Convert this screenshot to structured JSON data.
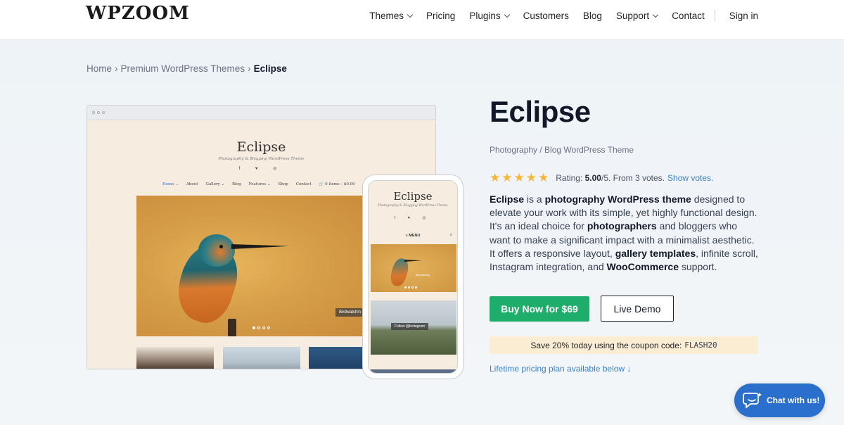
{
  "header": {
    "logo": "WPZOOM",
    "nav": {
      "themes": "Themes",
      "pricing": "Pricing",
      "plugins": "Plugins",
      "customers": "Customers",
      "blog": "Blog",
      "support": "Support",
      "contact": "Contact",
      "sign_in": "Sign in"
    }
  },
  "breadcrumb": {
    "home": "Home",
    "sep": "›",
    "category": "Premium WordPress Themes",
    "current": "Eclipse"
  },
  "preview": {
    "desktop": {
      "site_title": "Eclipse",
      "site_tagline": "Photography & Blogging WordPress Theme",
      "social": "f ♥ ◎",
      "nav": [
        "Home ⌄",
        "About",
        "Gallery ⌄",
        "Blog",
        "Features ⌄",
        "Shop",
        "Contact",
        "🛒 0 items – $0.00"
      ],
      "hero_label": "Birdwatchin"
    },
    "mobile": {
      "site_title": "Eclipse",
      "site_tagline": "Photography & Blogging WordPress Theme",
      "social": "f ♥ ◎",
      "menu": "≡ MENU",
      "search": "⌕",
      "hero_label": "Birdwatching",
      "follow": "Follow @Instagram"
    }
  },
  "product": {
    "title": "Eclipse",
    "subtitle": "Photography / Blog WordPress Theme",
    "rating": {
      "stars": 5,
      "label": "Rating:",
      "score": "5.00",
      "rest": "/5. From 3 votes.",
      "show_votes": "Show votes."
    },
    "description": {
      "p1": "Eclipse",
      "p2": " is a ",
      "p3": "photography WordPress theme",
      "p4": " designed to elevate your work with its simple, yet highly functional design. It's an ideal choice for ",
      "p5": "photographers",
      "p6": " and bloggers who want to make a significant impact with a minimalist aesthetic. It offers a responsive layout, ",
      "p7": "gallery templates",
      "p8": ", infinite scroll, Instagram integration, and ",
      "p9": "WooCommerce",
      "p10": " support."
    },
    "buy_label": "Buy Now for $69",
    "demo_label": "Live Demo",
    "coupon_text": "Save 20% today using the coupon code:",
    "coupon_code": "FLASH20",
    "lifetime": "Lifetime pricing plan available below ↓"
  },
  "chat": {
    "label": "Chat with us!"
  },
  "colors": {
    "buy_button": "#1fad6b",
    "star": "#f5b638",
    "link": "#3b82c4",
    "coupon_bg": "#fbecd4",
    "chat_bg": "#2a6fcb"
  }
}
